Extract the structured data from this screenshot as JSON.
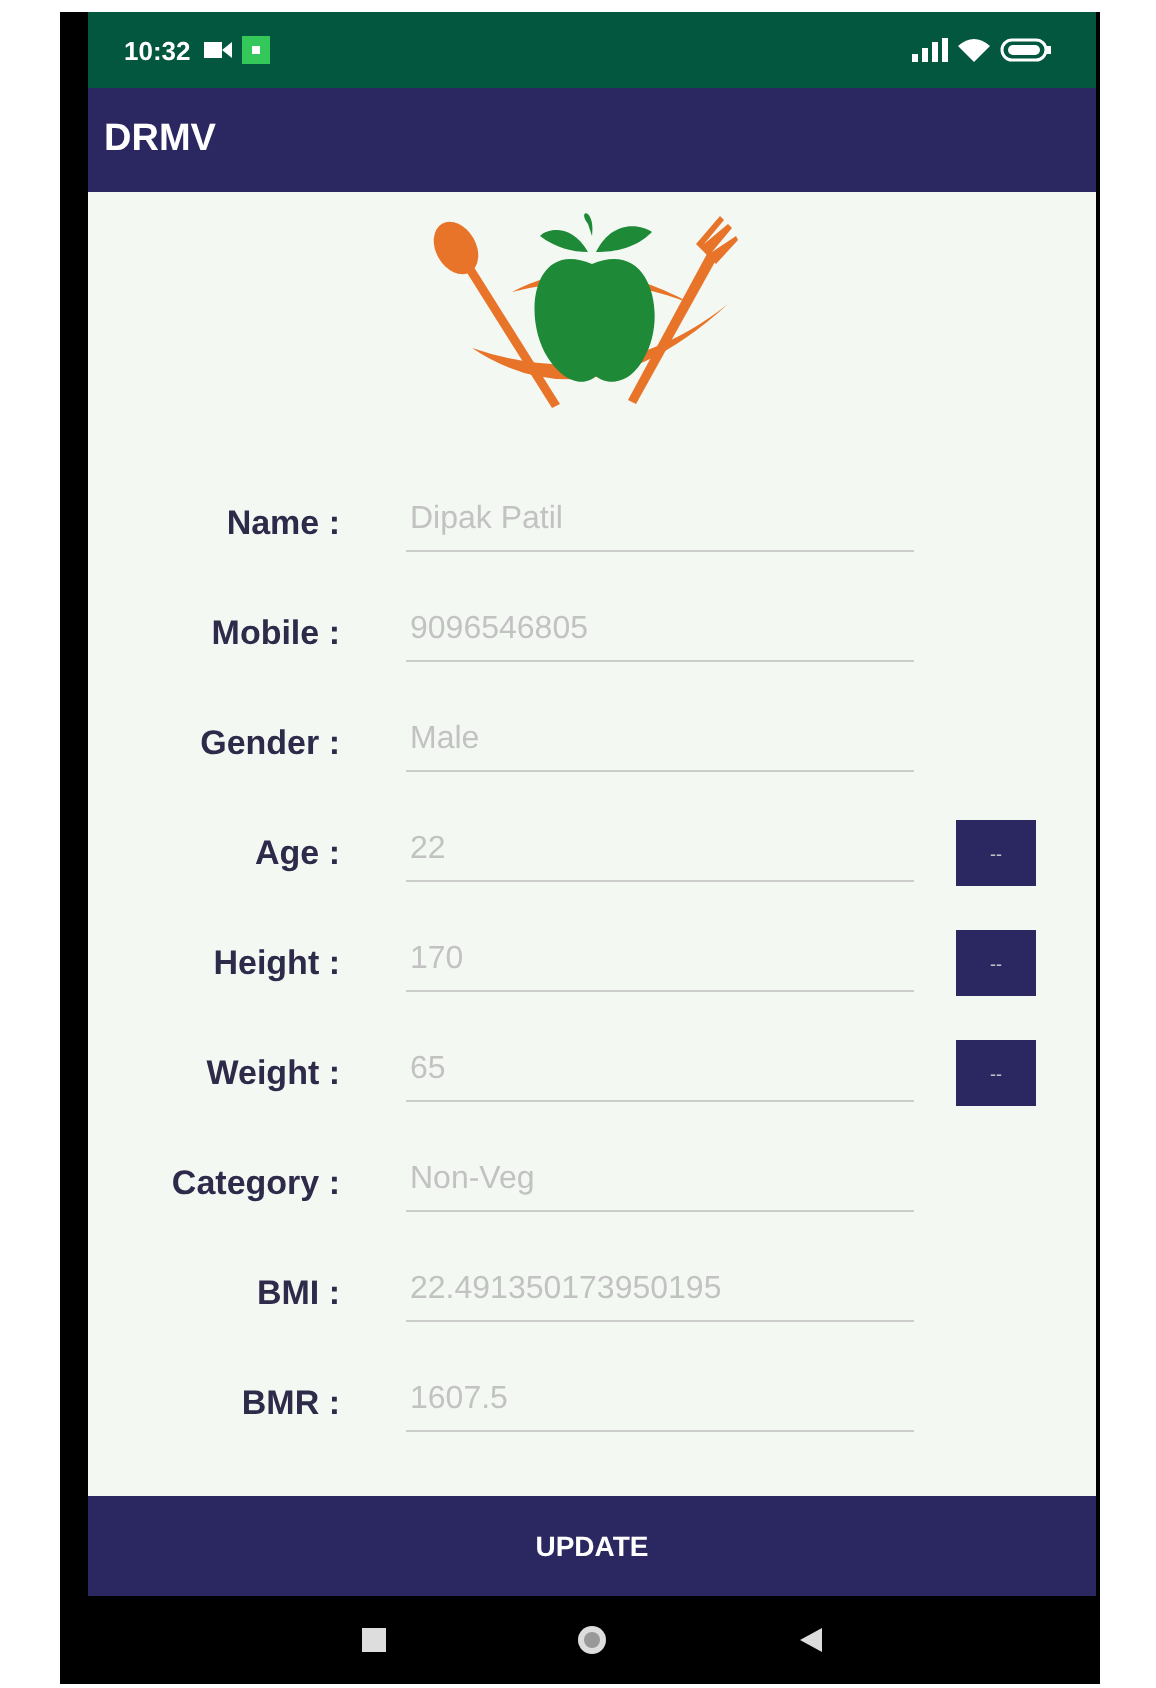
{
  "status_bar": {
    "time": "10:32"
  },
  "app_bar": {
    "title": "DRMV"
  },
  "fields": [
    {
      "label": "Name :",
      "value": "Dipak Patil"
    },
    {
      "label": "Mobile :",
      "value": "9096546805"
    },
    {
      "label": "Gender :",
      "value": "Male"
    },
    {
      "label": "Age :",
      "value": "22",
      "button": "--"
    },
    {
      "label": "Height :",
      "value": "170",
      "button": "--"
    },
    {
      "label": "Weight :",
      "value": "65",
      "button": "--"
    },
    {
      "label": "Category :",
      "value": "Non-Veg"
    },
    {
      "label": "BMI :",
      "value": "22.491350173950195"
    },
    {
      "label": "BMR :",
      "value": "1607.5"
    }
  ],
  "update_button": {
    "label": "UPDATE"
  }
}
